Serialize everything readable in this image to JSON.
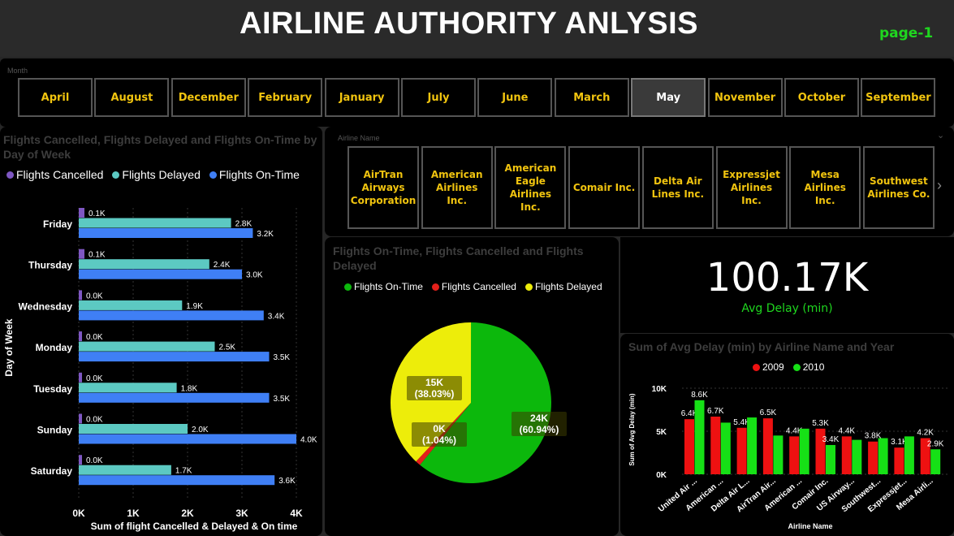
{
  "header": {
    "title": "AIRLINE AUTHORITY ANLYSIS ",
    "page_label": "page-1"
  },
  "month_slicer": {
    "label": "Month",
    "months": [
      "April",
      "August",
      "December",
      "February",
      "January",
      "July",
      "June",
      "March",
      "May",
      "November",
      "October",
      "September"
    ],
    "selected": "May"
  },
  "airline_slicer": {
    "label": "Airline Name",
    "airlines": [
      "AirTran Airways Corporation",
      "American Airlines Inc.",
      "American Eagle Airlines Inc.",
      "Comair Inc.",
      "Delta Air Lines Inc.",
      "Expressjet Airlines Inc.",
      "Mesa Airlines Inc.",
      "Southwest Airlines Co."
    ]
  },
  "kpi": {
    "value": "100.17K",
    "label": "Avg Delay (min)"
  },
  "colors": {
    "cancelled": "#7e57c2",
    "delayed": "#5cc9c2",
    "ontime": "#3f7ff5",
    "pie_ontime": "#0cb80c",
    "pie_cancelled": "#e3201b",
    "pie_delayed": "#eded0a",
    "y2009": "#ee1111",
    "y2010": "#16e016",
    "accent": "#f1c40f"
  },
  "chart_data": [
    {
      "type": "bar",
      "orientation": "horizontal",
      "title": "Flights Cancelled, Flights Delayed and Flights On-Time by Day of Week",
      "xlabel": "Sum of flight Cancelled & Delayed & On time",
      "ylabel": "Day of Week",
      "categories": [
        "Friday",
        "Thursday",
        "Wednesday",
        "Monday",
        "Tuesday",
        "Sunday",
        "Saturday"
      ],
      "xlim": [
        0,
        4000
      ],
      "x_ticks": [
        "0K",
        "1K",
        "2K",
        "3K",
        "4K"
      ],
      "series": [
        {
          "name": "Flights Cancelled",
          "values": [
            100,
            100,
            0,
            0,
            0,
            0,
            0
          ],
          "labels": [
            "0.1K",
            "0.1K",
            "0.0K",
            "0.0K",
            "0.0K",
            "0.0K",
            "0.0K"
          ]
        },
        {
          "name": "Flights Delayed",
          "values": [
            2800,
            2400,
            1900,
            2500,
            1800,
            2000,
            1700
          ],
          "labels": [
            "2.8K",
            "2.4K",
            "1.9K",
            "2.5K",
            "1.8K",
            "2.0K",
            "1.7K"
          ]
        },
        {
          "name": "Flights On-Time",
          "values": [
            3200,
            3000,
            3400,
            3500,
            3500,
            4000,
            3600
          ],
          "labels": [
            "3.2K",
            "3.0K",
            "3.4K",
            "3.5K",
            "3.5K",
            "4.0K",
            "3.6K"
          ]
        }
      ]
    },
    {
      "type": "pie",
      "title": "Flights On-Time, Flights Cancelled and Flights Delayed",
      "slices": [
        {
          "name": "Flights On-Time",
          "value": 24000,
          "label": "24K",
          "pct": "(60.94%)",
          "pct_value": 60.94
        },
        {
          "name": "Flights Cancelled",
          "value": 0,
          "label": "0K",
          "pct": "(1.04%)",
          "pct_value": 1.04
        },
        {
          "name": "Flights Delayed",
          "value": 15000,
          "label": "15K",
          "pct": "(38.03%)",
          "pct_value": 38.03
        }
      ]
    },
    {
      "type": "bar",
      "title": "Sum of Avg Delay (min) by Airline Name and Year",
      "xlabel": "Airline Name",
      "ylabel": "Sum of Avg Delay (min)",
      "categories": [
        "United Air ...",
        "American ...",
        "Delta Air L...",
        "AirTran Air...",
        "American ...",
        "Comair Inc.",
        "US Airway...",
        "Southwest...",
        "Expressjet...",
        "Mesa Airli..."
      ],
      "ylim": [
        0,
        10000
      ],
      "y_ticks": [
        "0K",
        "5K",
        "10K"
      ],
      "series": [
        {
          "name": "2009",
          "values": [
            6400,
            6700,
            5400,
            6500,
            4400,
            5300,
            4400,
            3800,
            3100,
            4200
          ],
          "labels": [
            "6.4K",
            "6.7K",
            "5.4K",
            "6.5K",
            "4.4K",
            "5.3K",
            "4.4K",
            "3.8K",
            "3.1K",
            "4.2K"
          ]
        },
        {
          "name": "2010",
          "values": [
            8600,
            6000,
            6600,
            4500,
            5300,
            3400,
            4000,
            4200,
            4400,
            2900
          ],
          "labels": [
            "8.6K",
            "",
            "",
            "",
            "",
            "3.4K",
            "",
            "",
            "",
            "2.9K"
          ]
        }
      ]
    }
  ]
}
